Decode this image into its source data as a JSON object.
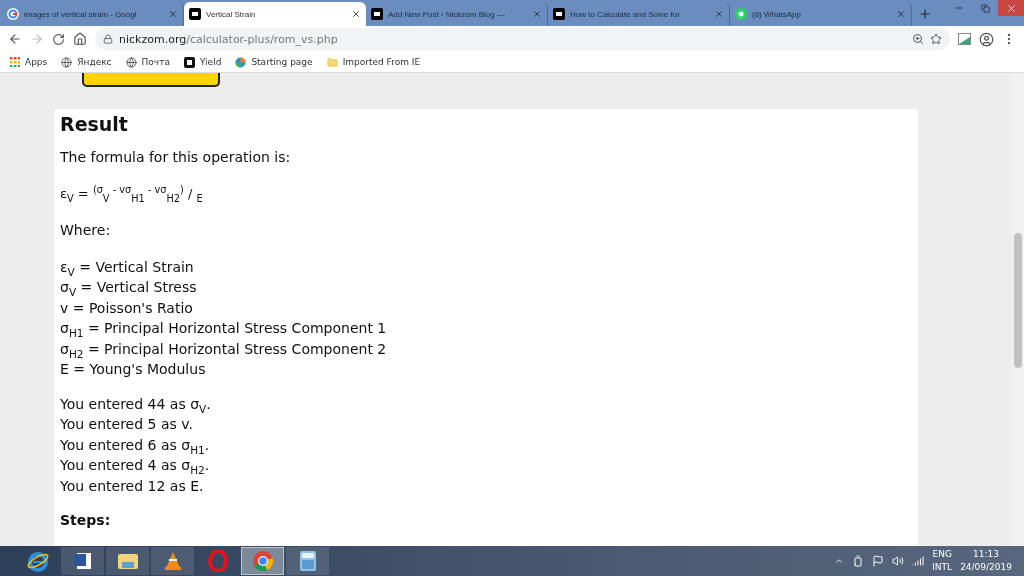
{
  "browser": {
    "tabs": [
      {
        "title": "images of vertical strain - Googl",
        "selected": false
      },
      {
        "title": "Vertical Strain",
        "selected": true
      },
      {
        "title": "Add New Post ‹ Nickzom Blog —",
        "selected": false
      },
      {
        "title": "How to Calculate and Solve for",
        "selected": false
      },
      {
        "title": "(8) WhatsApp",
        "selected": false
      }
    ],
    "address": {
      "host": "nickzom.org",
      "path": "/calculator-plus/rom_vs.php"
    },
    "bookmarks": [
      {
        "label": "Apps"
      },
      {
        "label": "Яндекс"
      },
      {
        "label": "Почта"
      },
      {
        "label": "Yield"
      },
      {
        "label": "Starting page"
      },
      {
        "label": "Imported From IE"
      }
    ]
  },
  "result": {
    "heading": "Result",
    "intro": "The formula for this operation is:",
    "formula": "ε$_{V}$ = $^{(σ}$$_{V}$$^{ - vσ}$$_{H1}$$^{ - vσ}$$_{H2}$$^{)}$ / $_{E}$",
    "where": "Where:",
    "definitions": [
      "ε$_{V}$ = Vertical Strain",
      "σ$_{V}$ = Vertical Stress",
      "v = Poisson's Ratio",
      "σ$_{H1}$ = Principal Horizontal Stress Component 1",
      "σ$_{H2}$ = Principal Horizontal Stress Component 2",
      "E = Young's Modulus"
    ],
    "entries": [
      "You entered 44 as σ$_{V}$.",
      "You entered 5 as v.",
      "You entered 6 as σ$_{H1}$.",
      "You entered 4 as σ$_{H2}$.",
      "You entered 12 as E."
    ],
    "steps_heading": "Steps:"
  },
  "taskbar": {
    "apps": [
      {
        "selected": false
      },
      {
        "selected": false
      },
      {
        "selected": false
      },
      {
        "selected": false
      },
      {
        "selected": false
      },
      {
        "selected": true
      },
      {
        "selected": false
      }
    ],
    "language": [
      "ENG",
      "INTL"
    ],
    "time": "11:13",
    "date": "24/09/2019"
  }
}
